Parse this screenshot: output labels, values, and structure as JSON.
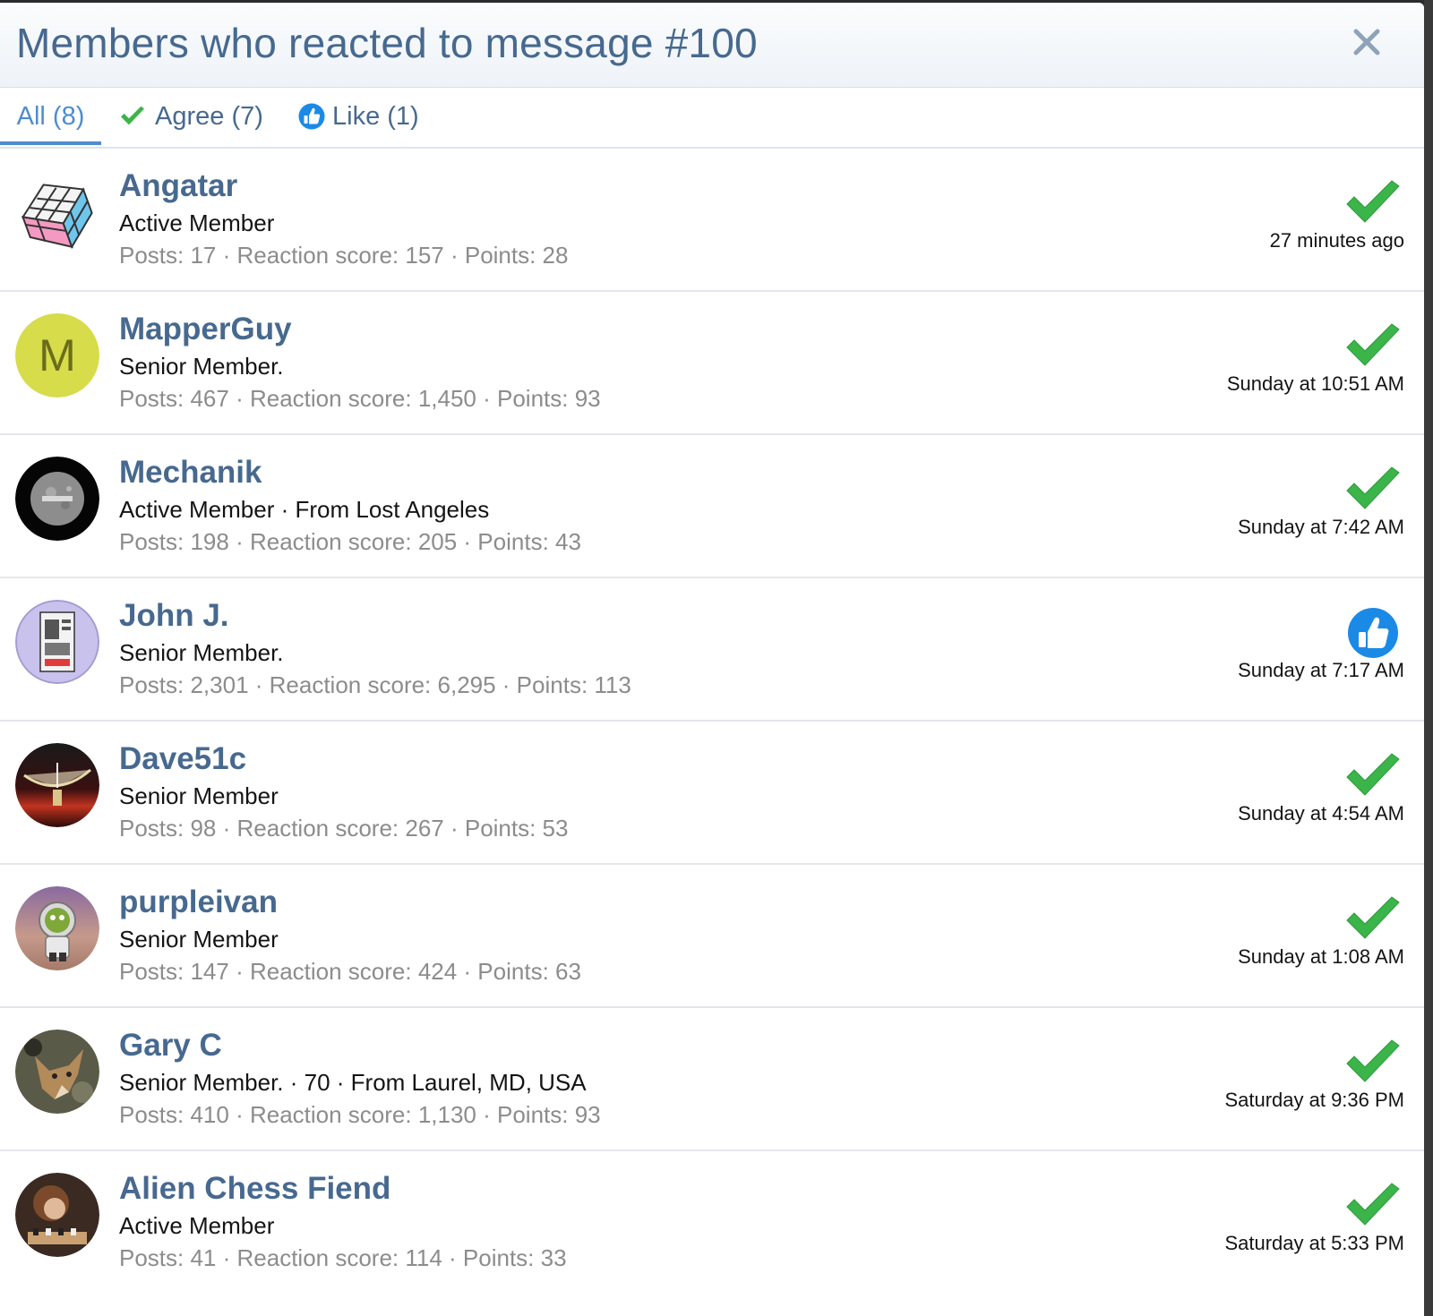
{
  "dialog": {
    "title": "Members who reacted to message #100",
    "close_icon": "close-icon"
  },
  "tabs": [
    {
      "label": "All (8)",
      "icon": "",
      "active": true
    },
    {
      "label": "Agree (7)",
      "icon": "checkmark-icon",
      "active": false
    },
    {
      "label": "Like (1)",
      "icon": "thumbs-up-icon",
      "active": false
    }
  ],
  "colors": {
    "link": "#47698f",
    "active_tab": "#4f8ccf",
    "agree_green": "#3bb54a",
    "like_blue": "#1a8ae6",
    "muted": "#8c8c8c"
  },
  "members": [
    {
      "name": "Angatar",
      "title": "Active Member",
      "stats": "Posts: 17 · Reaction score: 157 · Points: 28",
      "reaction": "agree",
      "time": "27 minutes ago",
      "avatar": "rubiks-cube"
    },
    {
      "name": "MapperGuy",
      "title": "Senior Member.",
      "stats": "Posts: 467 · Reaction score: 1,450 · Points: 93",
      "reaction": "agree",
      "time": "Sunday at 10:51 AM",
      "avatar": "letter",
      "avatar_letter": "M"
    },
    {
      "name": "Mechanik",
      "title": "Active Member · From Lost Angeles",
      "stats": "Posts: 198 · Reaction score: 205 · Points: 43",
      "reaction": "agree",
      "time": "Sunday at 7:42 AM",
      "avatar": "moon-disc"
    },
    {
      "name": "John J.",
      "title": "Senior Member.",
      "stats": "Posts: 2,301 · Reaction score: 6,295 · Points: 113",
      "reaction": "like",
      "time": "Sunday at 7:17 AM",
      "avatar": "poster"
    },
    {
      "name": "Dave51c",
      "title": "Senior Member",
      "stats": "Posts: 98 · Reaction score: 267 · Points: 53",
      "reaction": "agree",
      "time": "Sunday at 4:54 AM",
      "avatar": "radio-dish"
    },
    {
      "name": "purpleivan",
      "title": "Senior Member",
      "stats": "Posts: 147 · Reaction score: 424 · Points: 63",
      "reaction": "agree",
      "time": "Sunday at 1:08 AM",
      "avatar": "astronaut"
    },
    {
      "name": "Gary C",
      "title": "Senior Member. · 70 · From Laurel, MD, USA",
      "stats": "Posts: 410 · Reaction score: 1,130 · Points: 93",
      "reaction": "agree",
      "time": "Saturday at 9:36 PM",
      "avatar": "coyote"
    },
    {
      "name": "Alien Chess Fiend",
      "title": "Active Member",
      "stats": "Posts: 41 · Reaction score: 114 · Points: 33",
      "reaction": "agree",
      "time": "Saturday at 5:33 PM",
      "avatar": "chess-player"
    }
  ]
}
